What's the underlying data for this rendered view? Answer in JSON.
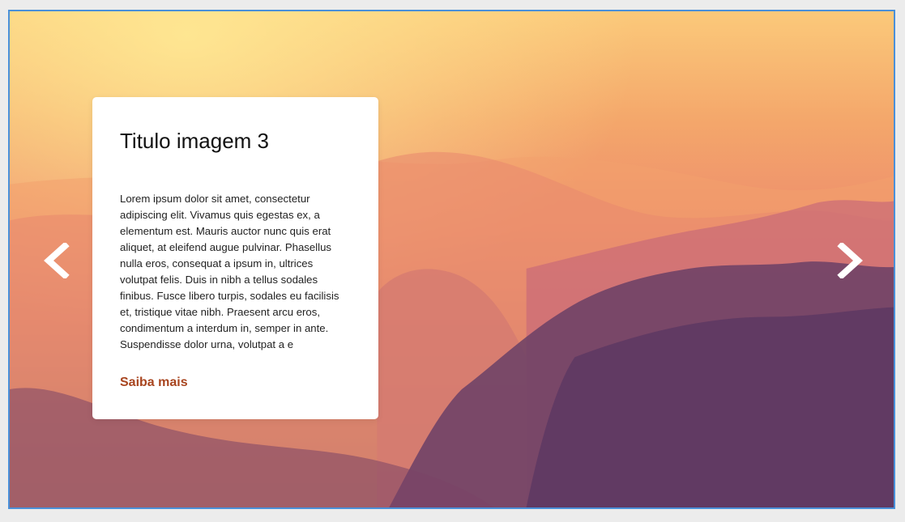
{
  "slide": {
    "image": "mountain-sunset-landscape",
    "title": "Titulo imagem 3",
    "text": "Lorem ipsum dolor sit amet, consectetur adipiscing elit. Vivamus quis egestas ex, a elementum est. Mauris auctor nunc quis erat aliquet, at eleifend augue pulvinar. Phasellus nulla eros, consequat a ipsum in, ultrices volutpat felis. Duis in nibh a tellus sodales finibus. Fusce libero turpis, sodales eu facilisis et, tristique vitae nibh. Praesent arcu eros, condimentum a interdum in, semper in ante. Suspendisse dolor urna, volutpat a e",
    "link_label": "Saiba mais"
  },
  "controls": {
    "prev_icon": "chevron-left-icon",
    "next_icon": "chevron-right-icon"
  },
  "colors": {
    "frame_border": "#4a90d9",
    "link": "#a8451f",
    "arrow": "#ffffff"
  }
}
